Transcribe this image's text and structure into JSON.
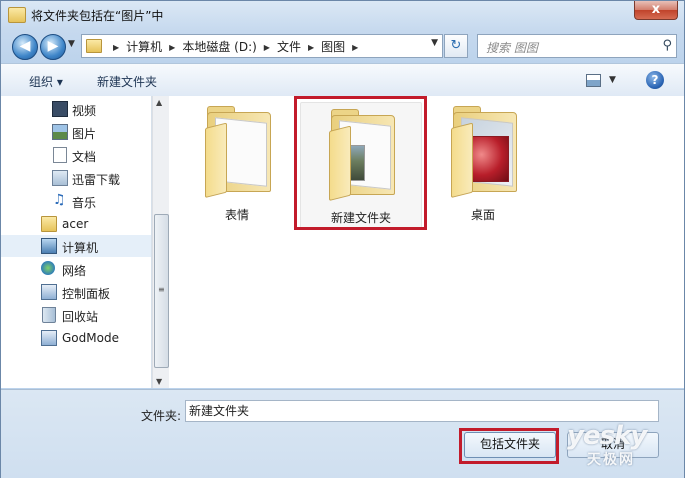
{
  "window": {
    "title": "将文件夹包括在“图片”中",
    "close_glyph": "x"
  },
  "address": {
    "crumbs": [
      "计算机",
      "本地磁盘 (D:)",
      "文件",
      "图图"
    ],
    "search_placeholder": "搜索 图图"
  },
  "toolbar": {
    "organize_label": "组织 ▾",
    "new_folder_label": "新建文件夹",
    "help_glyph": "?"
  },
  "nav": {
    "items": [
      {
        "label": "视频",
        "icon": "video-library-icon"
      },
      {
        "label": "图片",
        "icon": "pictures-library-icon"
      },
      {
        "label": "文档",
        "icon": "documents-library-icon"
      },
      {
        "label": "迅雷下载",
        "icon": "download-folder-icon"
      },
      {
        "label": "音乐",
        "icon": "music-library-icon"
      },
      {
        "label": "acer",
        "icon": "user-folder-icon"
      },
      {
        "label": "计算机",
        "icon": "computer-icon"
      },
      {
        "label": "网络",
        "icon": "network-icon"
      },
      {
        "label": "控制面板",
        "icon": "control-panel-icon"
      },
      {
        "label": "回收站",
        "icon": "recycle-bin-icon"
      },
      {
        "label": "GodMode",
        "icon": "godmode-icon"
      }
    ]
  },
  "files": [
    {
      "label": "表情"
    },
    {
      "label": "新建文件夹"
    },
    {
      "label": "桌面"
    }
  ],
  "footer": {
    "folder_label": "文件夹:",
    "folder_value": "新建文件夹",
    "include_button": "包括文件夹",
    "cancel_button": "取消"
  },
  "watermark": {
    "main": "yesky",
    "sub": "天极网"
  },
  "colors": {
    "highlight": "#c21b2b",
    "selection": "#e5eff9"
  }
}
